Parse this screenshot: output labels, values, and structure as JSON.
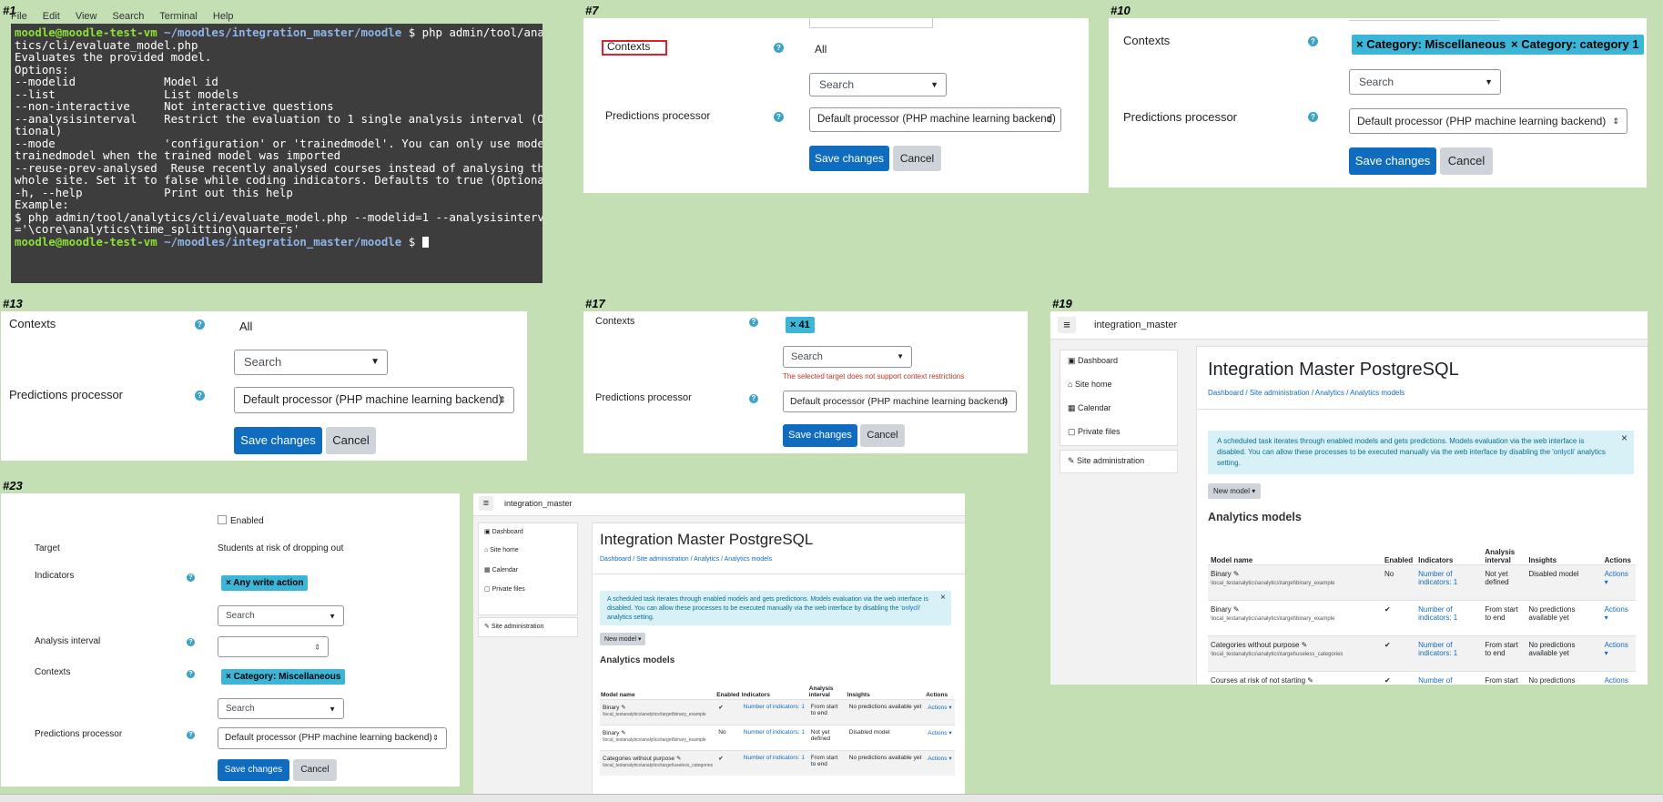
{
  "labels": {
    "p1": "#1",
    "p7": "#7",
    "p10": "#10",
    "p13": "#13",
    "p17": "#17",
    "p19": "#19",
    "p23": "#23"
  },
  "terminal": {
    "menu": [
      "File",
      "Edit",
      "View",
      "Search",
      "Terminal",
      "Help"
    ],
    "prompt_user": "moodle@moodle-test-vm",
    "prompt_path": "~/moodles/integration_master/moodle",
    "prompt_symbol": "$",
    "command_1": " php admin/tool/analy",
    "command_2": "tics/cli/evaluate_model.php",
    "lines": [
      "Evaluates the provided model.",
      "",
      "Options:",
      "--modelid             Model id",
      "--list                List models",
      "--non-interactive     Not interactive questions",
      "--analysisinterval    Restrict the evaluation to 1 single analysis interval (Op",
      "tional)",
      "--mode                'configuration' or 'trainedmodel'. You can only use mode=",
      "trainedmodel when the trained model was imported",
      "--reuse-prev-analysed  Reuse recently analysed courses instead of analysing the",
      "whole site. Set it to false while coding indicators. Defaults to true (Optional)",
      "-h, --help            Print out this help",
      "",
      "Example:",
      "$ php admin/tool/analytics/cli/evaluate_model.php --modelid=1 --analysisinterval",
      "='\\core\\analytics\\time_splitting\\quarters'"
    ]
  },
  "form": {
    "contexts": "Contexts",
    "all": "All",
    "search": "Search",
    "predictions_processor": "Predictions processor",
    "processor_value": "Default processor (PHP machine learning backend)",
    "save": "Save changes",
    "cancel": "Cancel",
    "enabled": "Enabled",
    "target": "Target",
    "target_value": "Students at risk of dropping out",
    "indicators": "Indicators",
    "analysis_interval": "Analysis interval",
    "tag_misc": "× Category: Miscellaneous",
    "tag_cat1": "× Category: category 1",
    "tag_41": "× 41",
    "tag_write": "× Any write action",
    "context_error": "The selected target does not support context restrictions",
    "help_glyph": "?",
    "arrow": "▼",
    "updown": "⇕"
  },
  "moodle": {
    "site": "integration_master",
    "hamburger": "≡",
    "nav": [
      "Dashboard",
      "Site home",
      "Calendar",
      "Private files"
    ],
    "admin": "Site administration",
    "title": "Integration Master PostgreSQL",
    "crumbs": [
      "Dashboard",
      "Site administration",
      "Analytics",
      "Analytics models"
    ],
    "alert_a": "A scheduled task iterates through enabled models and gets predictions. Models evaluation via the web interface is disabled. You can allow these processes to be executed manually via the web interface by disabling the ",
    "alert_link": "'onlycli'",
    "alert_b": " analytics setting.",
    "close": "×",
    "new_model": "New model ▾",
    "heading": "Analytics models",
    "cols": [
      "Model name",
      "Enabled",
      "Indicators",
      "Analysis interval",
      "Insights",
      "Actions"
    ],
    "rows19": [
      {
        "name": "Binary",
        "path": "\\local_testanalytics\\analytics\\target\\binary_example",
        "enabled": "No",
        "ind": "Number of indicators: 1",
        "interval": "Not yet defined",
        "insights": "Disabled model",
        "actions": "Actions ▾"
      },
      {
        "name": "Binary",
        "path": "\\local_testanalytics\\analytics\\target\\binary_example",
        "enabled": "✔",
        "ind": "Number of indicators: 1",
        "interval": "From start to end",
        "insights": "No predictions available yet",
        "actions": "Actions ▾"
      },
      {
        "name": "Categories without purpose",
        "path": "\\local_testanalytics\\analytics\\target\\useless_categories",
        "enabled": "✔",
        "ind": "Number of indicators: 1",
        "interval": "From start to end",
        "insights": "No predictions available yet",
        "actions": "Actions ▾"
      },
      {
        "name": "Courses at risk of not starting",
        "path": "",
        "enabled": "✔",
        "ind": "Number of",
        "interval": "From start to",
        "insights": "No predictions",
        "actions": "Actions ▾"
      }
    ],
    "rows_mid": [
      {
        "name": "Binary",
        "path": "\\local_testanalytics\\analytics\\target\\binary_example",
        "enabled": "✔",
        "ind": "Number of indicators: 1",
        "interval": "From start to end",
        "insights": "No predictions available yet",
        "actions": "Actions ▾"
      },
      {
        "name": "Binary",
        "path": "\\local_testanalytics\\analytics\\target\\binary_example",
        "enabled": "No",
        "ind": "Number of indicators: 1",
        "interval": "Not yet defined",
        "insights": "Disabled model",
        "actions": "Actions ▾"
      },
      {
        "name": "Categories without purpose",
        "path": "\\local_testanalytics\\analytics\\target\\useless_categories",
        "enabled": "✔",
        "ind": "Number of indicators: 1",
        "interval": "From start to end",
        "insights": "No predictions available yet",
        "actions": "Actions ▾"
      }
    ]
  }
}
